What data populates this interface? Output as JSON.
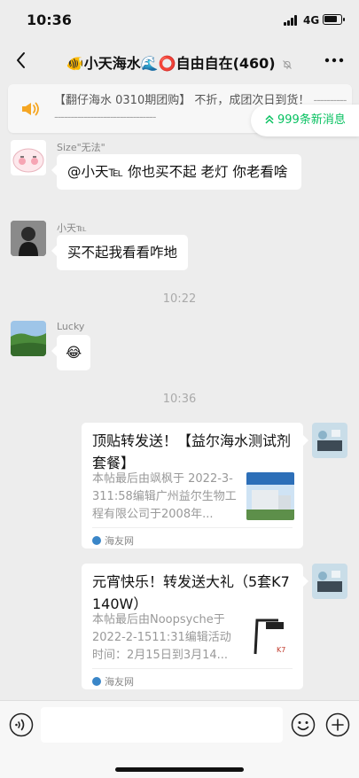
{
  "status_bar": {
    "time": "10:36",
    "network": "4G"
  },
  "header": {
    "title": "🐠小天海水🌊⭕自由自在(460)",
    "mute_icon": "bell-off-icon",
    "more_icon": "more-dots-icon"
  },
  "notice": {
    "text": "【翻仔海水 0310期团购】 不折，成团次日到货！",
    "dashes": "-----------------------------------------"
  },
  "new_messages": {
    "label": "999条新消息"
  },
  "messages": [
    {
      "sender": "Size\"无法\"",
      "text": "@小天℡ 你也买不起 老灯 你老看啥"
    },
    {
      "sender": "小天℡",
      "text": "买不起我看看咋地"
    },
    {
      "sender": "Lucky",
      "text": "😂"
    }
  ],
  "time_dividers": [
    "10:22",
    "10:36"
  ],
  "cards": [
    {
      "title": "顶贴转发送！【益尔海水测试剂套餐】",
      "description": "本帖最后由飒枫于 2022-3-311:58编辑广州益尔生物工程有限公司于2008年...",
      "source": "海友网",
      "thumb_icon": "building-photo-icon"
    },
    {
      "title": "元宵快乐！转发送大礼（5套K7 140W）",
      "description": "本帖最后由Noopsyche于2022-2-1511:31编辑活动时间：2月15日到3月14...",
      "source": "海友网",
      "thumb_icon": "aquarium-lamp-icon"
    }
  ],
  "input": {
    "value": "",
    "placeholder": ""
  },
  "colors": {
    "accent": "#07c160",
    "background": "#ededed"
  }
}
